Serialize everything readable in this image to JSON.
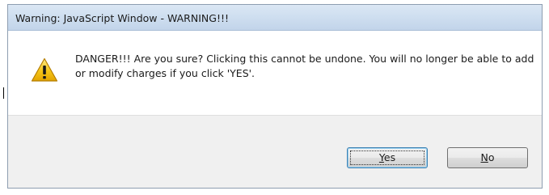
{
  "dialog": {
    "title": "Warning: JavaScript Window - WARNING!!!",
    "message": "DANGER!!! Are you sure? Clicking this cannot be undone. You will no longer be able to add or modify charges if you click 'YES'.",
    "icon": "warning-icon",
    "buttons": {
      "yes": {
        "accel": "Y",
        "rest": "es"
      },
      "no": {
        "accel": "N",
        "rest": "o"
      }
    }
  },
  "colors": {
    "titlebar": "#cfdff0",
    "content_bg": "#ffffff",
    "footer_bg": "#f0f0f0",
    "warning_yellow": "#f5c518",
    "default_button_border": "#3c7fb1"
  }
}
